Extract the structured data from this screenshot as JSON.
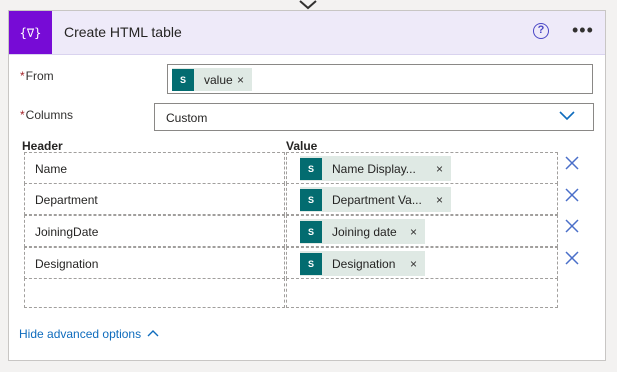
{
  "action": {
    "icon": "data-operation-icon",
    "icon_glyph": "{∇}",
    "title": "Create HTML table",
    "accent_color": "#770bd6",
    "header_bg": "#eeeaf9"
  },
  "from": {
    "label": "From",
    "required_mark": "*",
    "token": {
      "text": "value",
      "icon": "sharepoint-icon",
      "remove": "×"
    }
  },
  "columns": {
    "label": "Columns",
    "required_mark": "*",
    "selected": "Custom"
  },
  "table": {
    "header_label": "Header",
    "value_label": "Value",
    "rows": [
      {
        "header": "Name",
        "value": "Name Display...",
        "remove": "×"
      },
      {
        "header": "Department",
        "value": "Department Va...",
        "remove": "×"
      },
      {
        "header": "JoiningDate",
        "value": "Joining date",
        "remove": "×"
      },
      {
        "header": "Designation",
        "value": "Designation",
        "remove": "×"
      }
    ]
  },
  "advanced": {
    "link_text": "Hide advanced options"
  },
  "colors": {
    "token_bg": "#dfe9e4",
    "sharepoint_icon": "#036c70",
    "link": "#0f6cbd",
    "remove_icon": "#4a6fc9"
  }
}
